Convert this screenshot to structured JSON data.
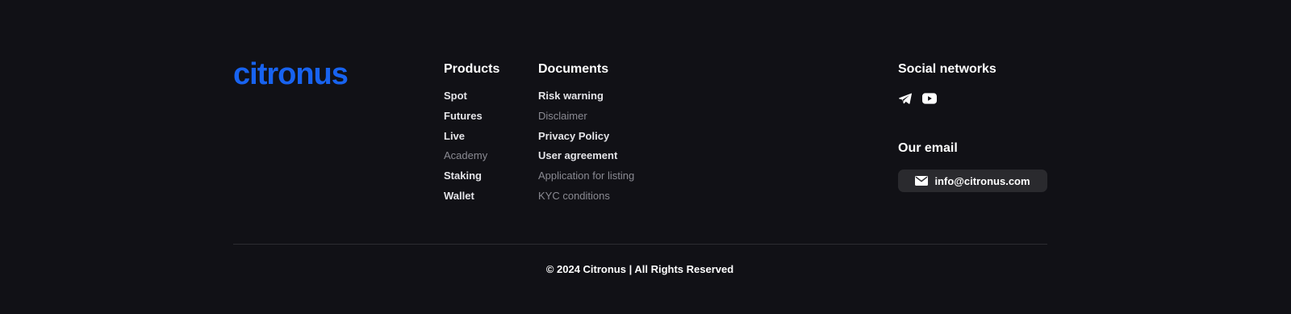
{
  "brand": {
    "logo_text": "citronus",
    "accent_color": "#1863f0"
  },
  "products": {
    "title": "Products",
    "items": [
      {
        "label": "Spot",
        "state": "active"
      },
      {
        "label": "Futures",
        "state": "active"
      },
      {
        "label": "Live",
        "state": "active"
      },
      {
        "label": "Academy",
        "state": "muted"
      },
      {
        "label": "Staking",
        "state": "active"
      },
      {
        "label": "Wallet",
        "state": "active"
      }
    ]
  },
  "documents": {
    "title": "Documents",
    "items": [
      {
        "label": "Risk warning",
        "state": "active"
      },
      {
        "label": "Disclaimer",
        "state": "muted"
      },
      {
        "label": "Privacy Policy",
        "state": "active"
      },
      {
        "label": "User agreement",
        "state": "active"
      },
      {
        "label": "Application for listing",
        "state": "muted"
      },
      {
        "label": "KYC conditions",
        "state": "muted"
      }
    ]
  },
  "social": {
    "title": "Social networks",
    "icons": [
      "telegram-icon",
      "youtube-icon"
    ]
  },
  "email": {
    "title": "Our email",
    "address": "info@citronus.com",
    "icon": "mail-icon"
  },
  "copyright": "© 2024 Citronus | All Rights Reserved"
}
